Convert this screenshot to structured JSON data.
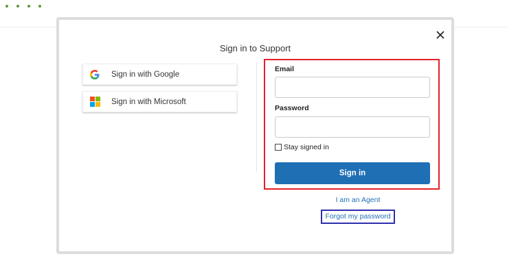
{
  "modal": {
    "title": "Sign in to Support"
  },
  "sso": {
    "google_label": "Sign in with Google",
    "microsoft_label": "Sign in with Microsoft"
  },
  "form": {
    "email_label": "Email",
    "email_value": "",
    "password_label": "Password",
    "password_value": "",
    "stay_signed_in_label": "Stay signed in",
    "stay_signed_in_checked": false,
    "submit_label": "Sign in"
  },
  "links": {
    "agent": "I am an Agent",
    "forgot_password": "Forgot my password"
  },
  "colors": {
    "accent": "#1f6fb5",
    "highlight_red": "#e41e26",
    "highlight_blue": "#2d2dad",
    "google_blue": "#4285f4",
    "ms_red": "#f25022",
    "ms_green": "#7fba00",
    "ms_blue": "#00a4ef",
    "ms_yellow": "#ffb900"
  },
  "icons": {
    "close": "close-icon",
    "google": "google-logo-icon",
    "microsoft": "microsoft-logo-icon",
    "loading": "loading-dots-icon"
  }
}
